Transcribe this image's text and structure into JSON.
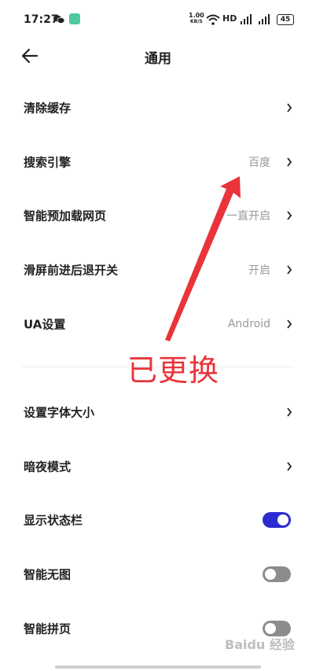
{
  "status_bar": {
    "time": "17:27",
    "net_speed_value": "1.00",
    "net_speed_unit": "KB/S",
    "hd_label": "HD",
    "battery": "45"
  },
  "header": {
    "title": "通用"
  },
  "settings": {
    "clear_cache": {
      "label": "清除缓存"
    },
    "search_engine": {
      "label": "搜索引擎",
      "value": "百度"
    },
    "smart_preload": {
      "label": "智能预加载网页",
      "value": "一直开启"
    },
    "swipe_nav": {
      "label": "滑屏前进后退开关",
      "value": "开启"
    },
    "ua": {
      "label": "UA设置",
      "value": "Android"
    },
    "font_size": {
      "label": "设置字体大小"
    },
    "dark_mode": {
      "label": "暗夜模式"
    },
    "show_statusbar": {
      "label": "显示状态栏",
      "enabled": true
    },
    "no_image": {
      "label": "智能无图",
      "enabled": false
    },
    "page_join": {
      "label": "智能拼页",
      "enabled": false
    }
  },
  "annotation": {
    "text": "已更换",
    "color": "#e8343a"
  },
  "watermark": "Baidu 经验",
  "colors": {
    "toggle_on": "#2d2bd1",
    "toggle_off": "#8c8c8c",
    "secondary_text": "#9a9a9a"
  }
}
